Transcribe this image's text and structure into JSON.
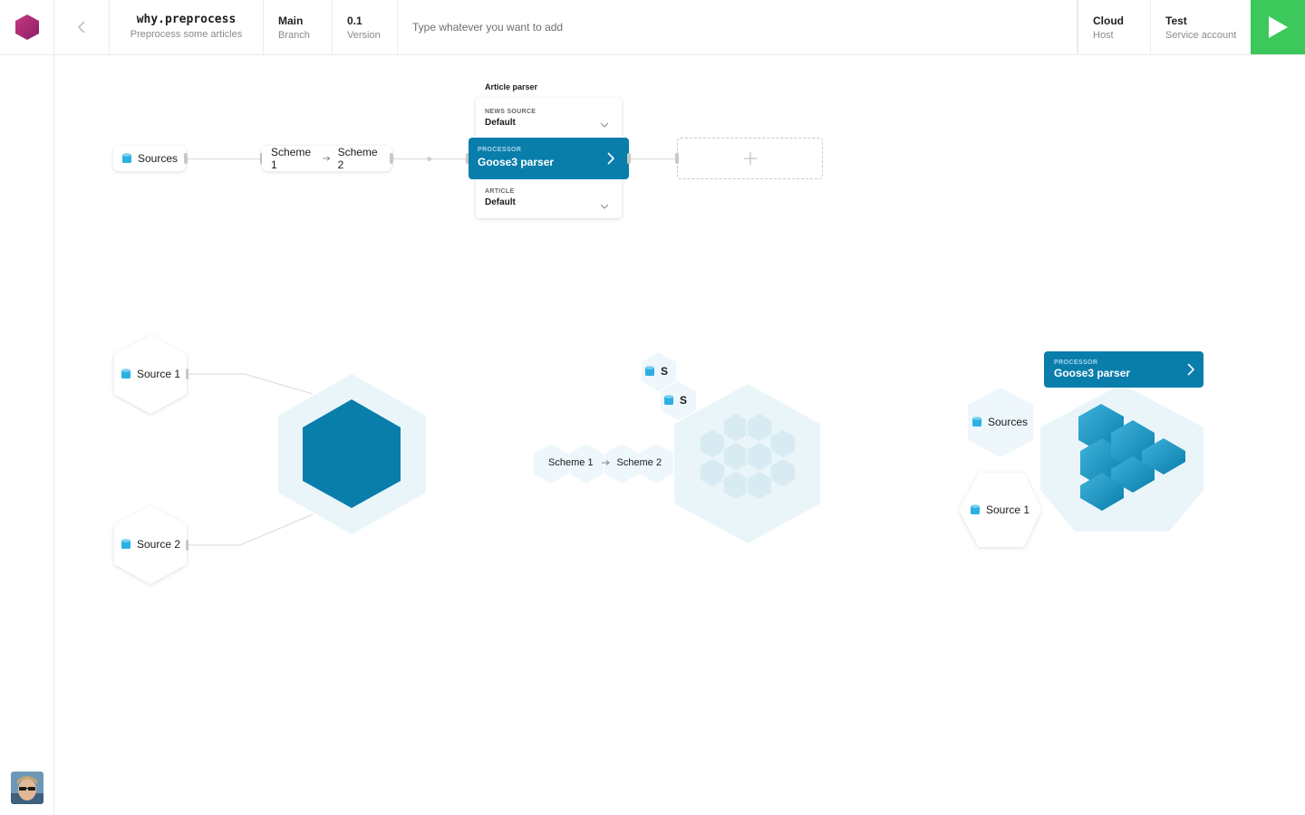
{
  "header": {
    "project_name": "why.preprocess",
    "project_desc": "Preprocess some articles",
    "branch_value": "Main",
    "branch_label": "Branch",
    "version_value": "0.1",
    "version_label": "Version",
    "input_placeholder": "Type whatever you want to add",
    "host_value": "Cloud",
    "host_label": "Host",
    "account_value": "Test",
    "account_label": "Service account"
  },
  "icons": {
    "logo": "hexagon-logo-icon",
    "back": "chevron-left-icon",
    "run": "play-icon",
    "database": "database-icon",
    "add": "plus-icon"
  },
  "colors": {
    "logo": "#a4236e",
    "accent": "#0a7eab",
    "run": "#3cc85a",
    "hex_light": "#eaf5fa",
    "database": "#2bb0e3"
  },
  "pipeline": {
    "sources_label": "Sources",
    "scheme_from": "Scheme 1",
    "scheme_to": "Scheme 2",
    "group_title": "Article parser",
    "news_source_label": "NEWS SOURCE",
    "news_source_value": "Default",
    "processor_label": "PROCESSOR",
    "processor_value": "Goose3 parser",
    "article_label": "ARTICLE",
    "article_value": "Default"
  },
  "hex_view_1": {
    "source_1": "Source 1",
    "source_2": "Source 2"
  },
  "hex_view_2": {
    "s_top": "S",
    "s_mid": "S",
    "scheme_from": "Scheme 1",
    "scheme_to": "Scheme 2"
  },
  "hex_view_3": {
    "processor_label": "PROCESSOR",
    "processor_value": "Goose3 parser",
    "sources_label": "Sources",
    "source_1": "Source 1"
  }
}
